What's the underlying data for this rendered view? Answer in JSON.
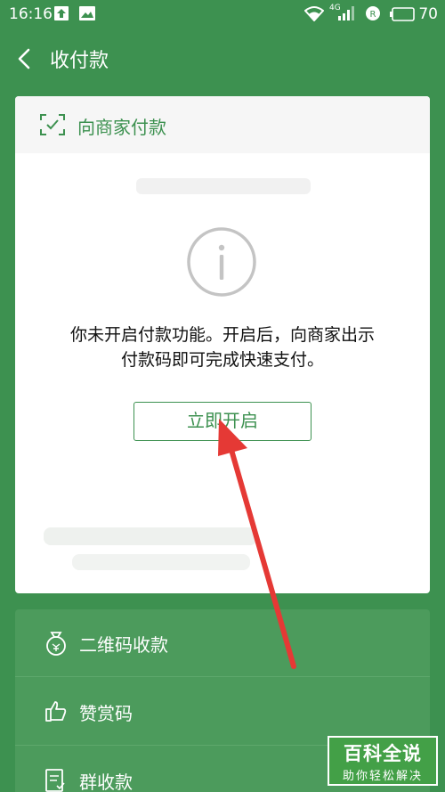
{
  "status_bar": {
    "time": "16:16",
    "network": "4G",
    "battery": "70",
    "icons": [
      "upload-icon",
      "image-icon",
      "wifi-icon",
      "signal-icon",
      "data-saver-icon",
      "battery-icon"
    ]
  },
  "header": {
    "back_icon": "chevron-left-icon",
    "title": "收付款"
  },
  "pay_card": {
    "header_icon": "scan-icon",
    "header_label": "向商家付款",
    "info_icon": "info-icon",
    "message_line1": "你未开启付款功能。开启后，向商家出示",
    "message_line2": "付款码即可完成快速支付。",
    "open_button": "立即开启"
  },
  "list": {
    "items": [
      {
        "icon": "money-bag-icon",
        "label": "二维码收款"
      },
      {
        "icon": "thumbs-up-icon",
        "label": "赞赏码"
      },
      {
        "icon": "receipt-icon",
        "label": "群收款"
      }
    ]
  },
  "watermark": {
    "title": "百科全说",
    "subtitle": "助你轻松解决"
  },
  "colors": {
    "brand_green": "#3d9150",
    "annotation_arrow": "#e53935"
  }
}
